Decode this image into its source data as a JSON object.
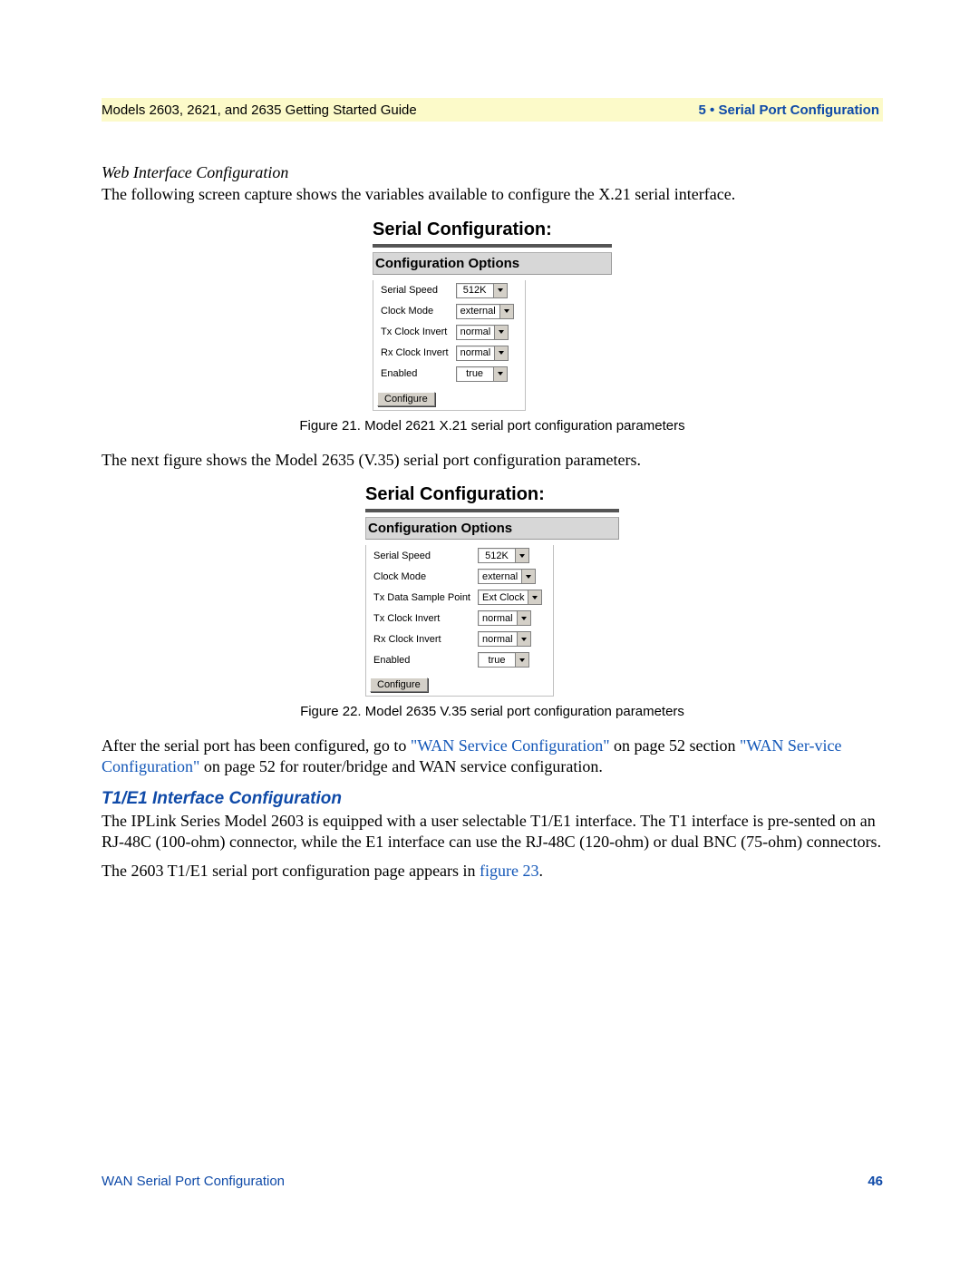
{
  "header": {
    "left": "Models 2603, 2621, and 2635 Getting Started Guide",
    "right": "5 • Serial Port Configuration"
  },
  "intro": {
    "heading": "Web Interface Configuration",
    "text": "The following screen capture shows the variables available to configure the X.21 serial interface."
  },
  "panel1": {
    "title": "Serial Configuration:",
    "subtitle": "Configuration Options",
    "rows": [
      {
        "label": "Serial Speed",
        "value": "512K"
      },
      {
        "label": "Clock Mode",
        "value": "external"
      },
      {
        "label": "Tx Clock Invert",
        "value": "normal"
      },
      {
        "label": "Rx Clock Invert",
        "value": "normal"
      },
      {
        "label": "Enabled",
        "value": "true"
      }
    ],
    "button": "Configure",
    "caption": "Figure 21. Model 2621 X.21 serial port configuration parameters"
  },
  "mid_text": "The next figure shows the Model 2635 (V.35) serial port configuration parameters.",
  "panel2": {
    "title": "Serial Configuration:",
    "subtitle": "Configuration Options",
    "rows": [
      {
        "label": "Serial Speed",
        "value": "512K"
      },
      {
        "label": "Clock Mode",
        "value": "external"
      },
      {
        "label": "Tx Data Sample Point",
        "value": "Ext Clock"
      },
      {
        "label": "Tx Clock Invert",
        "value": "normal"
      },
      {
        "label": "Rx Clock Invert",
        "value": "normal"
      },
      {
        "label": "Enabled",
        "value": "true"
      }
    ],
    "button": "Configure",
    "caption": "Figure 22. Model 2635 V.35 serial port configuration parameters"
  },
  "after": {
    "pre": "After the serial port has been configured, go to ",
    "link1": "\"WAN Service Configuration\"",
    "mid1": " on page 52 section ",
    "link2": "\"WAN Ser-vice Configuration\"",
    "mid2": " on page 52 for router/bridge and WAN service configuration."
  },
  "t1e1": {
    "heading": "T1/E1 Interface Configuration",
    "p1": "The IPLink Series Model 2603 is equipped with a user selectable T1/E1 interface. The T1 interface is pre-sented on an RJ-48C (100-ohm) connector, while the E1 interface can use the RJ-48C (120-ohm) or dual BNC (75-ohm) connectors.",
    "p2_pre": "The 2603 T1/E1 serial port configuration page appears in ",
    "p2_link": "figure 23",
    "p2_post": "."
  },
  "footer": {
    "left": "WAN Serial Port Configuration",
    "page": "46"
  }
}
